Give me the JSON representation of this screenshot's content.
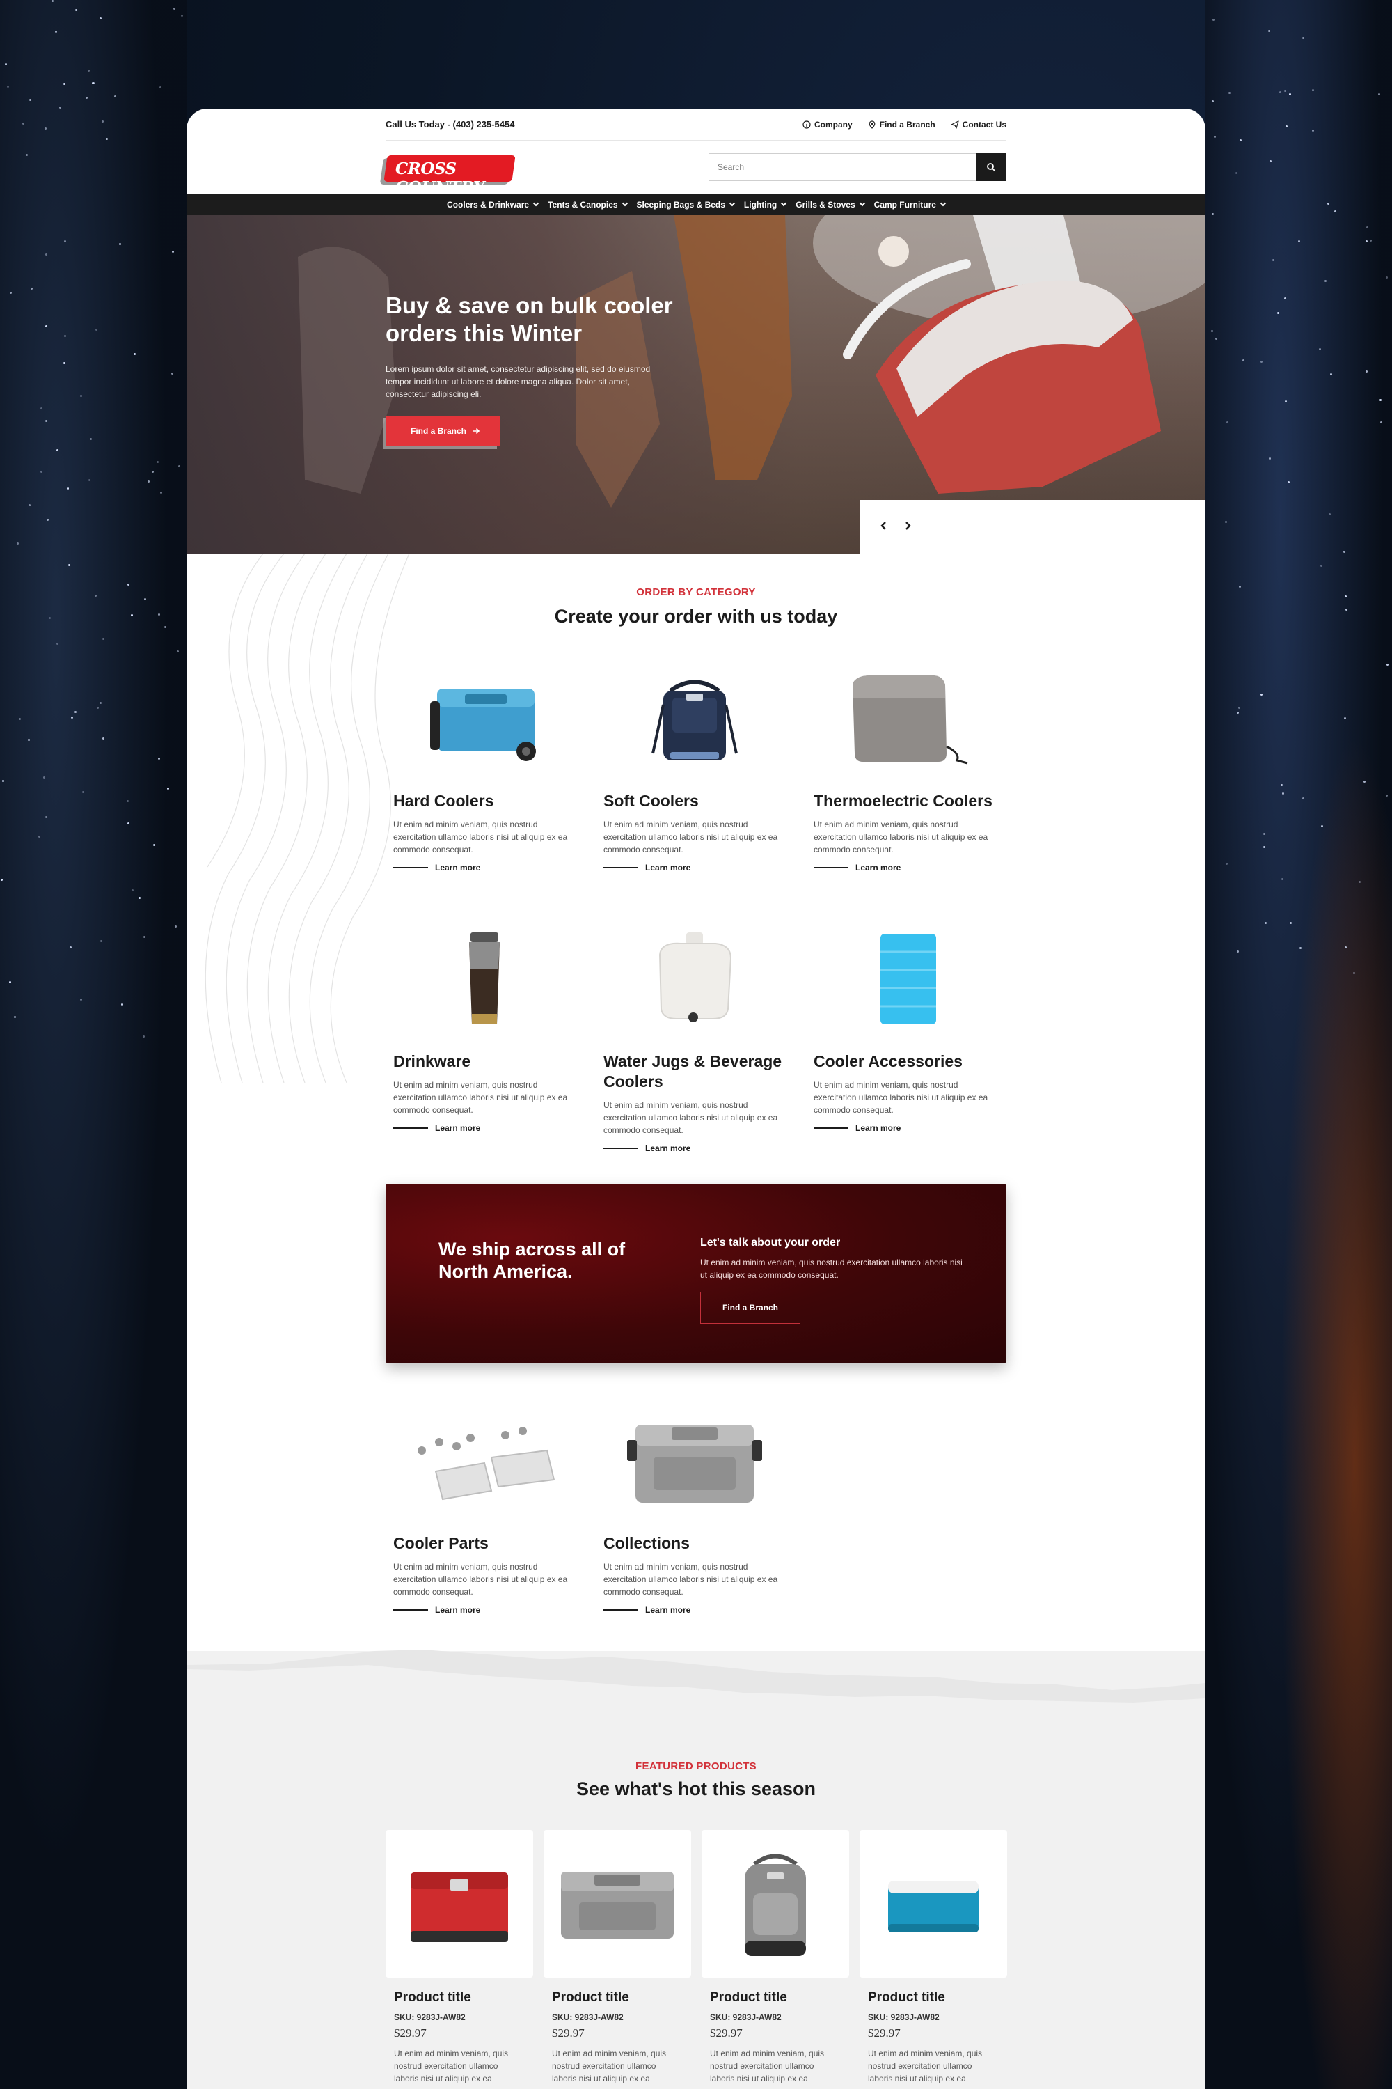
{
  "topbar": {
    "phone": "Call Us Today - (403) 235-5454",
    "links": [
      {
        "icon": "info-icon",
        "label": "Company"
      },
      {
        "icon": "location-pin-icon",
        "label": "Find a Branch"
      },
      {
        "icon": "send-icon",
        "label": "Contact Us"
      }
    ]
  },
  "header": {
    "logo_text": "CROSS COUNTRY",
    "search_placeholder": "Search"
  },
  "nav": {
    "items": [
      "Coolers & Drinkware",
      "Tents & Canopies",
      "Sleeping Bags & Beds",
      "Lighting",
      "Grills & Stoves",
      "Camp Furniture"
    ]
  },
  "hero": {
    "title": "Buy & save on bulk cooler orders this Winter",
    "text": "Lorem ipsum dolor sit amet, consectetur adipiscing elit, sed do eiusmod tempor incididunt ut labore et dolore magna aliqua. Dolor sit amet, consectetur adipiscing eli.",
    "button": "Find a Branch"
  },
  "categories": {
    "kicker": "ORDER BY CATEGORY",
    "title": "Create your order with us today",
    "learn_more": "Learn more",
    "items": [
      {
        "title": "Hard Coolers",
        "desc": "Ut enim ad minim veniam, quis nostrud exercitation ullamco laboris nisi ut aliquip ex ea commodo consequat."
      },
      {
        "title": "Soft Coolers",
        "desc": "Ut enim ad minim veniam, quis nostrud exercitation ullamco laboris nisi ut aliquip ex ea commodo consequat."
      },
      {
        "title": "Thermoelectric Coolers",
        "desc": "Ut enim ad minim veniam, quis nostrud exercitation ullamco laboris nisi ut aliquip ex ea commodo consequat."
      },
      {
        "title": "Drinkware",
        "desc": "Ut enim ad minim veniam, quis nostrud exercitation ullamco laboris nisi ut aliquip ex ea commodo consequat."
      },
      {
        "title": "Water Jugs & Beverage Coolers",
        "desc": "Ut enim ad minim veniam, quis nostrud exercitation ullamco laboris nisi ut aliquip ex ea commodo consequat."
      },
      {
        "title": "Cooler Accessories",
        "desc": "Ut enim ad minim veniam, quis nostrud exercitation ullamco laboris nisi ut aliquip ex ea commodo consequat."
      },
      {
        "title": "Cooler Parts",
        "desc": "Ut enim ad minim veniam, quis nostrud exercitation ullamco laboris nisi ut aliquip ex ea commodo consequat."
      },
      {
        "title": "Collections",
        "desc": "Ut enim ad minim veniam, quis nostrud exercitation ullamco laboris nisi ut aliquip ex ea commodo consequat."
      }
    ]
  },
  "ship": {
    "title": "We ship across all of North America.",
    "subtitle": "Let's talk about your order",
    "text": "Ut enim ad minim veniam, quis nostrud exercitation ullamco laboris nisi ut aliquip ex ea commodo consequat.",
    "button": "Find a Branch"
  },
  "featured": {
    "kicker": "FEATURED PRODUCTS",
    "title": "See what's hot this season",
    "products": [
      {
        "title": "Product title",
        "sku": "SKU: 9283J-AW82",
        "price": "$29.97",
        "desc": "Ut enim ad minim veniam, quis nostrud exercitation ullamco laboris nisi ut aliquip ex ea"
      },
      {
        "title": "Product title",
        "sku": "SKU: 9283J-AW82",
        "price": "$29.97",
        "desc": "Ut enim ad minim veniam, quis nostrud exercitation ullamco laboris nisi ut aliquip ex ea"
      },
      {
        "title": "Product title",
        "sku": "SKU: 9283J-AW82",
        "price": "$29.97",
        "desc": "Ut enim ad minim veniam, quis nostrud exercitation ullamco laboris nisi ut aliquip ex ea"
      },
      {
        "title": "Product title",
        "sku": "SKU: 9283J-AW82",
        "price": "$29.97",
        "desc": "Ut enim ad minim veniam, quis nostrud exercitation ullamco laboris nisi ut aliquip ex ea"
      }
    ]
  },
  "colors": {
    "brand_red": "#e31b23",
    "accent_red": "#d2323a",
    "dark": "#1c1c1c",
    "banner_maroon": "#3e0608"
  }
}
